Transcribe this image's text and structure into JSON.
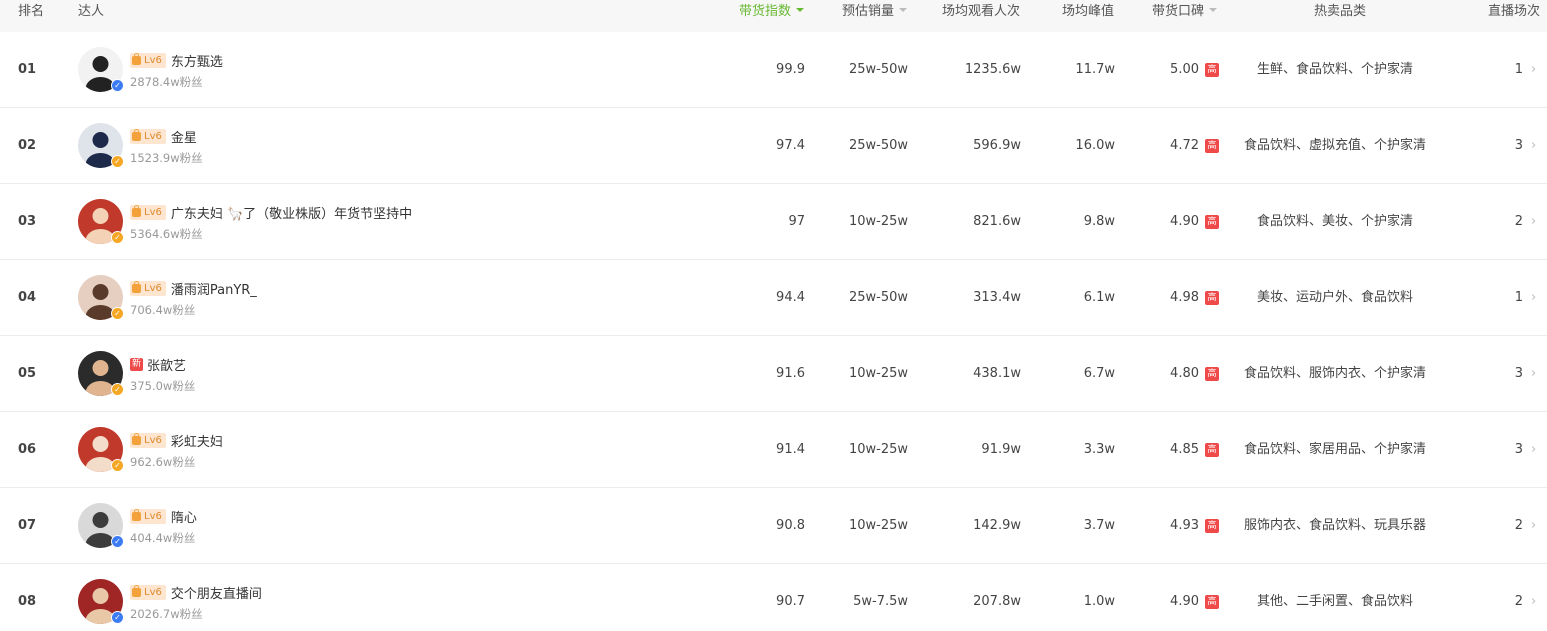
{
  "header": {
    "rank": "排名",
    "creator": "达人",
    "sales_index": "带货指数",
    "est_sales": "预估销量",
    "avg_viewers": "场均观看人次",
    "avg_peak": "场均峰值",
    "reputation": "带货口碑",
    "hot_categories": "热卖品类",
    "live_sessions": "直播场次"
  },
  "colors": {
    "active_sort": "#68b832",
    "badge_red": "#ee4a4a",
    "level_bg": "#fde5cf",
    "verify_blue": "#3b7cf6",
    "verify_gold": "#f5a623"
  },
  "rows": [
    {
      "rank": "01",
      "level": "Lv6",
      "name": "东方甄选",
      "fans": "2878.4w粉丝",
      "index": "99.9",
      "sales": "25w-50w",
      "viewers": "1235.6w",
      "peak": "11.7w",
      "rating": "5.00",
      "rating_tag": "高",
      "cats": "生鲜、食品饮料、个护家清",
      "sessions": "1",
      "verify": "blue"
    },
    {
      "rank": "02",
      "level": "Lv6",
      "name": "金星",
      "fans": "1523.9w粉丝",
      "index": "97.4",
      "sales": "25w-50w",
      "viewers": "596.9w",
      "peak": "16.0w",
      "rating": "4.72",
      "rating_tag": "高",
      "cats": "食品饮料、虚拟充值、个护家清",
      "sessions": "3",
      "verify": "gold"
    },
    {
      "rank": "03",
      "level": "Lv6",
      "name": "广东夫妇 🦙了（敬业株版）年货节坚持中",
      "fans": "5364.6w粉丝",
      "index": "97",
      "sales": "10w-25w",
      "viewers": "821.6w",
      "peak": "9.8w",
      "rating": "4.90",
      "rating_tag": "高",
      "cats": "食品饮料、美妆、个护家清",
      "sessions": "2",
      "verify": "gold"
    },
    {
      "rank": "04",
      "level": "Lv6",
      "name": "潘雨润PanYR_",
      "fans": "706.4w粉丝",
      "index": "94.4",
      "sales": "25w-50w",
      "viewers": "313.4w",
      "peak": "6.1w",
      "rating": "4.98",
      "rating_tag": "高",
      "cats": "美妆、运动户外、食品饮料",
      "sessions": "1",
      "verify": "gold"
    },
    {
      "rank": "05",
      "level": "",
      "new_tag": "新",
      "name": "张歆艺",
      "fans": "375.0w粉丝",
      "index": "91.6",
      "sales": "10w-25w",
      "viewers": "438.1w",
      "peak": "6.7w",
      "rating": "4.80",
      "rating_tag": "高",
      "cats": "食品饮料、服饰内衣、个护家清",
      "sessions": "3",
      "verify": "gold"
    },
    {
      "rank": "06",
      "level": "Lv6",
      "name": "彩虹夫妇",
      "fans": "962.6w粉丝",
      "index": "91.4",
      "sales": "10w-25w",
      "viewers": "91.9w",
      "peak": "3.3w",
      "rating": "4.85",
      "rating_tag": "高",
      "cats": "食品饮料、家居用品、个护家清",
      "sessions": "3",
      "verify": "gold"
    },
    {
      "rank": "07",
      "level": "Lv6",
      "name": "隋心",
      "fans": "404.4w粉丝",
      "index": "90.8",
      "sales": "10w-25w",
      "viewers": "142.9w",
      "peak": "3.7w",
      "rating": "4.93",
      "rating_tag": "高",
      "cats": "服饰内衣、食品饮料、玩具乐器",
      "sessions": "2",
      "verify": "blue"
    },
    {
      "rank": "08",
      "level": "Lv6",
      "name": "交个朋友直播间",
      "fans": "2026.7w粉丝",
      "index": "90.7",
      "sales": "5w-7.5w",
      "viewers": "207.8w",
      "peak": "1.0w",
      "rating": "4.90",
      "rating_tag": "高",
      "cats": "其他、二手闲置、食品饮料",
      "sessions": "2",
      "verify": "blue"
    }
  ]
}
